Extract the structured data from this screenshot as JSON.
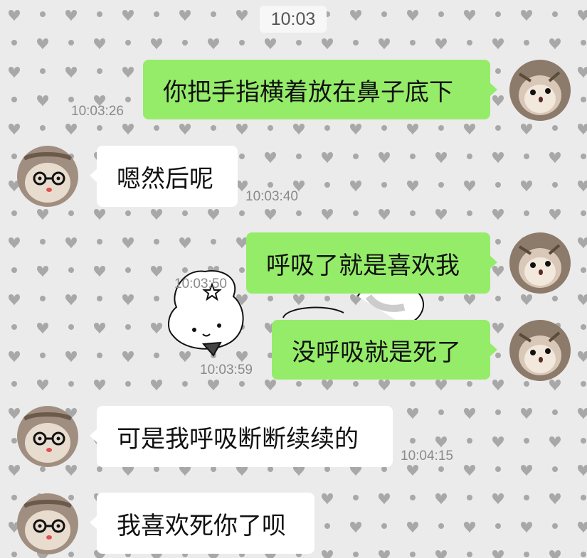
{
  "header_time": "10:03",
  "messages": [
    {
      "side": "right",
      "text": "你把手指横着放在鼻子底下",
      "time": "10:03:26"
    },
    {
      "side": "left",
      "text": "嗯然后呢",
      "time": "10:03:40"
    },
    {
      "side": "right",
      "text": "呼吸了就是喜欢我",
      "time": "10:03:50"
    },
    {
      "side": "right",
      "text": "没呼吸就是死了",
      "time": "10:03:59"
    },
    {
      "side": "left",
      "text": "可是我呼吸断断续续的",
      "time": "10:04:15"
    },
    {
      "side": "left",
      "text": "我喜欢死你了呗",
      "time": ""
    }
  ],
  "colors": {
    "sent_bubble": "#95ec69",
    "received_bubble": "#ffffff",
    "background": "#ebebeb",
    "heart_pattern": "#a8a8a8"
  },
  "icons": {
    "self_avatar": "hamster-photo-avatar",
    "partner_avatar": "hamster-with-glasses-avatar",
    "sticker": "white-bunny-sticker"
  }
}
